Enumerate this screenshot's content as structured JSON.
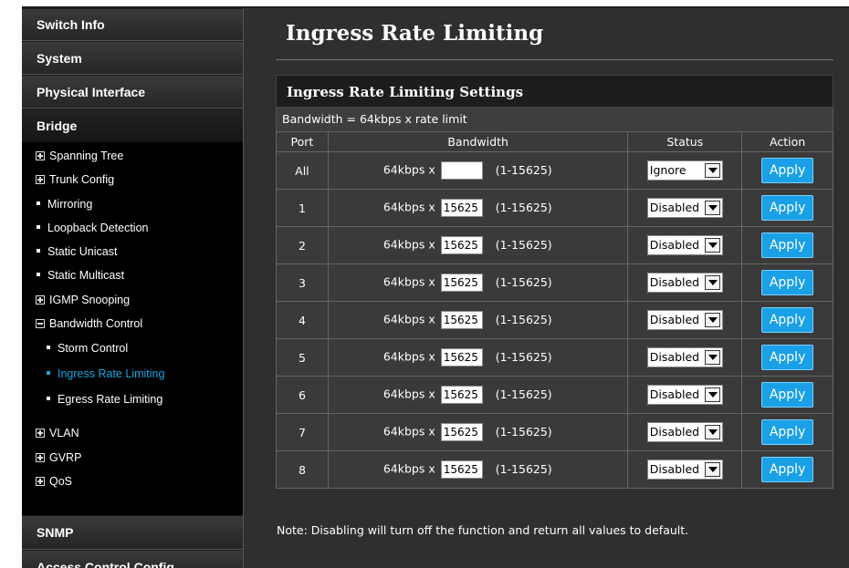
{
  "sidebar": {
    "sections": {
      "switch_info": "Switch Info",
      "system": "System",
      "physical_interface": "Physical Interface",
      "bridge": "Bridge",
      "snmp": "SNMP",
      "access_control": "Access Control Config"
    },
    "bridge_items": {
      "spanning_tree": "Spanning Tree",
      "trunk_config": "Trunk Config",
      "mirroring": "Mirroring",
      "loopback_detection": "Loopback Detection",
      "static_unicast": "Static Unicast",
      "static_multicast": "Static Multicast",
      "igmp_snooping": "IGMP Snooping",
      "bandwidth_control": "Bandwidth Control",
      "storm_control": "Storm Control",
      "ingress_rate_limiting": "Ingress Rate Limiting",
      "egress_rate_limiting": "Egress Rate Limiting",
      "vlan": "VLAN",
      "gvrp": "GVRP",
      "qos": "QoS"
    },
    "active_color": "#1aa5e0"
  },
  "main": {
    "title": "Ingress Rate Limiting",
    "panel_title": "Ingress Rate Limiting Settings",
    "bandwidth_note": "Bandwidth = 64kbps x rate limit",
    "columns": {
      "port": "Port",
      "bandwidth": "Bandwidth",
      "status": "Status",
      "action": "Action"
    },
    "rows": [
      {
        "port": "All",
        "prefix": "64kbps x",
        "value": "",
        "range": "(1-15625)",
        "status": "Ignore",
        "action": "Apply"
      },
      {
        "port": "1",
        "prefix": "64kbps x",
        "value": "15625",
        "range": "(1-15625)",
        "status": "Disabled",
        "action": "Apply"
      },
      {
        "port": "2",
        "prefix": "64kbps x",
        "value": "15625",
        "range": "(1-15625)",
        "status": "Disabled",
        "action": "Apply"
      },
      {
        "port": "3",
        "prefix": "64kbps x",
        "value": "15625",
        "range": "(1-15625)",
        "status": "Disabled",
        "action": "Apply"
      },
      {
        "port": "4",
        "prefix": "64kbps x",
        "value": "15625",
        "range": "(1-15625)",
        "status": "Disabled",
        "action": "Apply"
      },
      {
        "port": "5",
        "prefix": "64kbps x",
        "value": "15625",
        "range": "(1-15625)",
        "status": "Disabled",
        "action": "Apply"
      },
      {
        "port": "6",
        "prefix": "64kbps x",
        "value": "15625",
        "range": "(1-15625)",
        "status": "Disabled",
        "action": "Apply"
      },
      {
        "port": "7",
        "prefix": "64kbps x",
        "value": "15625",
        "range": "(1-15625)",
        "status": "Disabled",
        "action": "Apply"
      },
      {
        "port": "8",
        "prefix": "64kbps x",
        "value": "15625",
        "range": "(1-15625)",
        "status": "Disabled",
        "action": "Apply"
      }
    ],
    "footnote": "Note: Disabling will turn off the function and return all values to default.",
    "apply_color": "#1aa0e6"
  }
}
